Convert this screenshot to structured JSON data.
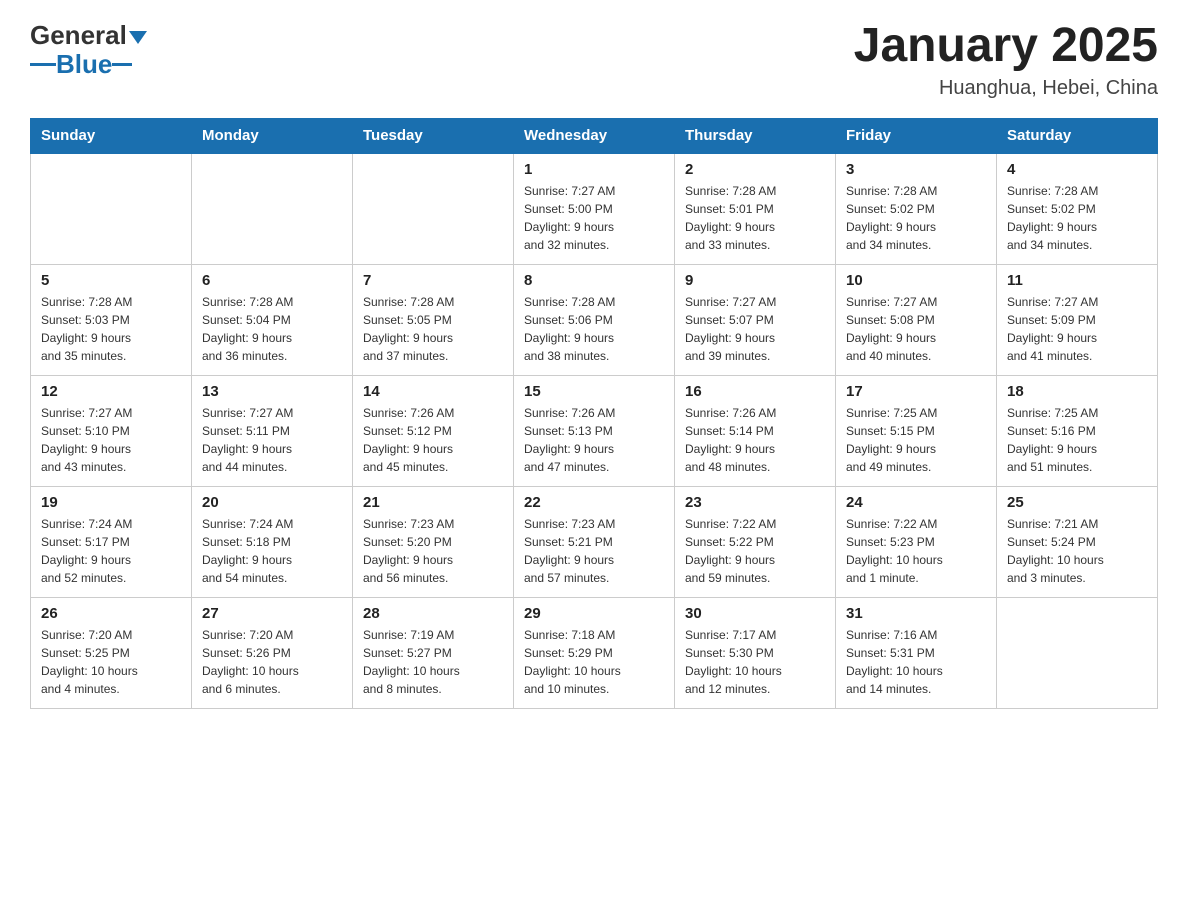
{
  "header": {
    "logo_general": "General",
    "logo_blue": "Blue",
    "month_title": "January 2025",
    "location": "Huanghua, Hebei, China"
  },
  "days_of_week": [
    "Sunday",
    "Monday",
    "Tuesday",
    "Wednesday",
    "Thursday",
    "Friday",
    "Saturday"
  ],
  "weeks": [
    [
      {
        "day": "",
        "info": ""
      },
      {
        "day": "",
        "info": ""
      },
      {
        "day": "",
        "info": ""
      },
      {
        "day": "1",
        "info": "Sunrise: 7:27 AM\nSunset: 5:00 PM\nDaylight: 9 hours\nand 32 minutes."
      },
      {
        "day": "2",
        "info": "Sunrise: 7:28 AM\nSunset: 5:01 PM\nDaylight: 9 hours\nand 33 minutes."
      },
      {
        "day": "3",
        "info": "Sunrise: 7:28 AM\nSunset: 5:02 PM\nDaylight: 9 hours\nand 34 minutes."
      },
      {
        "day": "4",
        "info": "Sunrise: 7:28 AM\nSunset: 5:02 PM\nDaylight: 9 hours\nand 34 minutes."
      }
    ],
    [
      {
        "day": "5",
        "info": "Sunrise: 7:28 AM\nSunset: 5:03 PM\nDaylight: 9 hours\nand 35 minutes."
      },
      {
        "day": "6",
        "info": "Sunrise: 7:28 AM\nSunset: 5:04 PM\nDaylight: 9 hours\nand 36 minutes."
      },
      {
        "day": "7",
        "info": "Sunrise: 7:28 AM\nSunset: 5:05 PM\nDaylight: 9 hours\nand 37 minutes."
      },
      {
        "day": "8",
        "info": "Sunrise: 7:28 AM\nSunset: 5:06 PM\nDaylight: 9 hours\nand 38 minutes."
      },
      {
        "day": "9",
        "info": "Sunrise: 7:27 AM\nSunset: 5:07 PM\nDaylight: 9 hours\nand 39 minutes."
      },
      {
        "day": "10",
        "info": "Sunrise: 7:27 AM\nSunset: 5:08 PM\nDaylight: 9 hours\nand 40 minutes."
      },
      {
        "day": "11",
        "info": "Sunrise: 7:27 AM\nSunset: 5:09 PM\nDaylight: 9 hours\nand 41 minutes."
      }
    ],
    [
      {
        "day": "12",
        "info": "Sunrise: 7:27 AM\nSunset: 5:10 PM\nDaylight: 9 hours\nand 43 minutes."
      },
      {
        "day": "13",
        "info": "Sunrise: 7:27 AM\nSunset: 5:11 PM\nDaylight: 9 hours\nand 44 minutes."
      },
      {
        "day": "14",
        "info": "Sunrise: 7:26 AM\nSunset: 5:12 PM\nDaylight: 9 hours\nand 45 minutes."
      },
      {
        "day": "15",
        "info": "Sunrise: 7:26 AM\nSunset: 5:13 PM\nDaylight: 9 hours\nand 47 minutes."
      },
      {
        "day": "16",
        "info": "Sunrise: 7:26 AM\nSunset: 5:14 PM\nDaylight: 9 hours\nand 48 minutes."
      },
      {
        "day": "17",
        "info": "Sunrise: 7:25 AM\nSunset: 5:15 PM\nDaylight: 9 hours\nand 49 minutes."
      },
      {
        "day": "18",
        "info": "Sunrise: 7:25 AM\nSunset: 5:16 PM\nDaylight: 9 hours\nand 51 minutes."
      }
    ],
    [
      {
        "day": "19",
        "info": "Sunrise: 7:24 AM\nSunset: 5:17 PM\nDaylight: 9 hours\nand 52 minutes."
      },
      {
        "day": "20",
        "info": "Sunrise: 7:24 AM\nSunset: 5:18 PM\nDaylight: 9 hours\nand 54 minutes."
      },
      {
        "day": "21",
        "info": "Sunrise: 7:23 AM\nSunset: 5:20 PM\nDaylight: 9 hours\nand 56 minutes."
      },
      {
        "day": "22",
        "info": "Sunrise: 7:23 AM\nSunset: 5:21 PM\nDaylight: 9 hours\nand 57 minutes."
      },
      {
        "day": "23",
        "info": "Sunrise: 7:22 AM\nSunset: 5:22 PM\nDaylight: 9 hours\nand 59 minutes."
      },
      {
        "day": "24",
        "info": "Sunrise: 7:22 AM\nSunset: 5:23 PM\nDaylight: 10 hours\nand 1 minute."
      },
      {
        "day": "25",
        "info": "Sunrise: 7:21 AM\nSunset: 5:24 PM\nDaylight: 10 hours\nand 3 minutes."
      }
    ],
    [
      {
        "day": "26",
        "info": "Sunrise: 7:20 AM\nSunset: 5:25 PM\nDaylight: 10 hours\nand 4 minutes."
      },
      {
        "day": "27",
        "info": "Sunrise: 7:20 AM\nSunset: 5:26 PM\nDaylight: 10 hours\nand 6 minutes."
      },
      {
        "day": "28",
        "info": "Sunrise: 7:19 AM\nSunset: 5:27 PM\nDaylight: 10 hours\nand 8 minutes."
      },
      {
        "day": "29",
        "info": "Sunrise: 7:18 AM\nSunset: 5:29 PM\nDaylight: 10 hours\nand 10 minutes."
      },
      {
        "day": "30",
        "info": "Sunrise: 7:17 AM\nSunset: 5:30 PM\nDaylight: 10 hours\nand 12 minutes."
      },
      {
        "day": "31",
        "info": "Sunrise: 7:16 AM\nSunset: 5:31 PM\nDaylight: 10 hours\nand 14 minutes."
      },
      {
        "day": "",
        "info": ""
      }
    ]
  ]
}
